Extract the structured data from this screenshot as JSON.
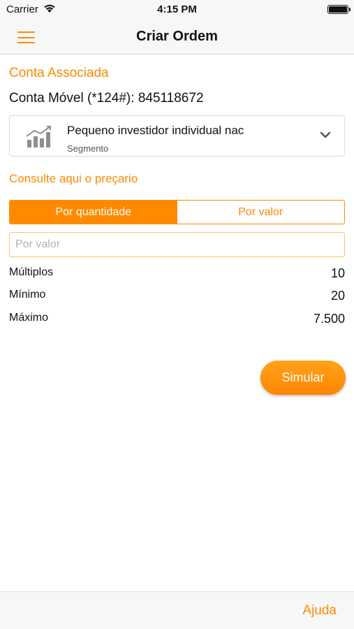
{
  "status_bar": {
    "carrier": "Carrier",
    "time": "4:15 PM"
  },
  "nav": {
    "title": "Criar Ordem",
    "menu_icon": "hamburger-menu-icon"
  },
  "account": {
    "section_title": "Conta Associada",
    "line": "Conta Móvel (*124#): 845118672"
  },
  "segment": {
    "name": "Pequeno investidor individual nac",
    "label": "Segmento",
    "icon": "bar-chart-icon"
  },
  "pricing_link": "Consulte aqui o preçario",
  "mode_toggle": {
    "options": [
      {
        "label": "Por quantidade",
        "selected": true
      },
      {
        "label": "Por valor",
        "selected": false
      }
    ]
  },
  "input": {
    "placeholder": "Por valor",
    "value": ""
  },
  "limits": [
    {
      "label": "Múltiplos",
      "value": "10"
    },
    {
      "label": "Mínimo",
      "value": "20"
    },
    {
      "label": "Máximo",
      "value": "7.500"
    }
  ],
  "simulate_button": "Simular",
  "footer": {
    "help": "Ajuda"
  },
  "colors": {
    "accent": "#ff8a00",
    "input_border": "#f7c46c",
    "bar_bg": "#f7f7f7"
  }
}
